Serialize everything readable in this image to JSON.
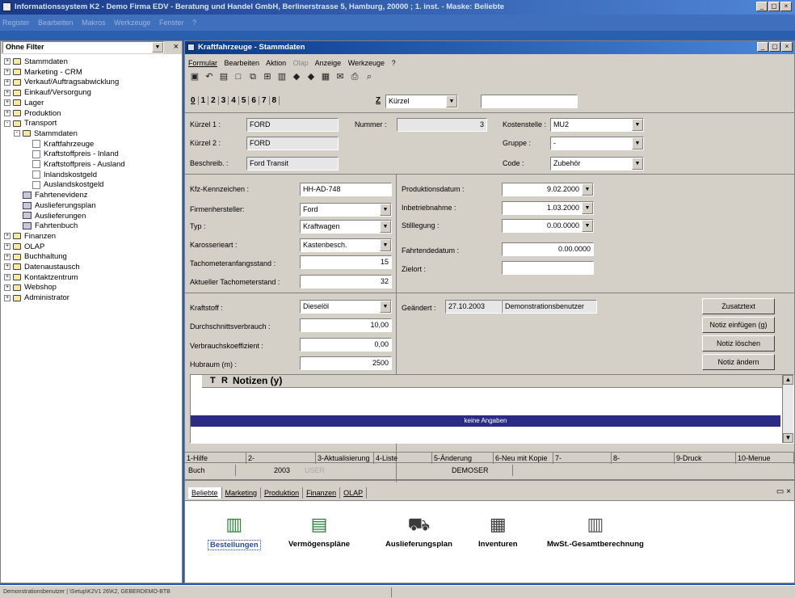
{
  "app": {
    "title": "Informationssystem K2 - Demo Firma EDV - Beratung und Handel GmbH, Berlinerstrasse 5, Hamburg, 20000 ; 1. inst. - Maske: Beliebte",
    "menu": [
      "Register",
      "Bearbeiten",
      "Makros",
      "Werkzeuge",
      "Fenster",
      "?"
    ]
  },
  "sidebar": {
    "filter": "Ohne Filter",
    "items": [
      {
        "label": "Stammdaten",
        "level": 0,
        "sign": "+",
        "icon": "folder"
      },
      {
        "label": "Marketing - CRM",
        "level": 0,
        "sign": "+",
        "icon": "folder"
      },
      {
        "label": "Verkauf/Auftragsabwicklung",
        "level": 0,
        "sign": "+",
        "icon": "folder"
      },
      {
        "label": "Einkauf/Versorgung",
        "level": 0,
        "sign": "+",
        "icon": "folder"
      },
      {
        "label": "Lager",
        "level": 0,
        "sign": "+",
        "icon": "folder"
      },
      {
        "label": "Produktion",
        "level": 0,
        "sign": "+",
        "icon": "folder"
      },
      {
        "label": "Transport",
        "level": 0,
        "sign": "-",
        "icon": "folder"
      },
      {
        "label": "Stammdaten",
        "level": 1,
        "sign": "-",
        "icon": "folder"
      },
      {
        "label": "Kraftfahrzeuge",
        "level": 2,
        "sign": "",
        "icon": "doc"
      },
      {
        "label": "Kraftstoffpreis - Inland",
        "level": 2,
        "sign": "",
        "icon": "doc"
      },
      {
        "label": "Kraftstoffpreis - Ausland",
        "level": 2,
        "sign": "",
        "icon": "doc"
      },
      {
        "label": "Inlandskostgeld",
        "level": 2,
        "sign": "",
        "icon": "doc"
      },
      {
        "label": "Auslandskostgeld",
        "level": 2,
        "sign": "",
        "icon": "doc"
      },
      {
        "label": "Fahrtenevidenz",
        "level": 1,
        "sign": "",
        "icon": "book"
      },
      {
        "label": "Auslieferungsplan",
        "level": 1,
        "sign": "",
        "icon": "book"
      },
      {
        "label": "Auslieferungen",
        "level": 1,
        "sign": "",
        "icon": "book"
      },
      {
        "label": "Fahrtenbuch",
        "level": 1,
        "sign": "",
        "icon": "book"
      },
      {
        "label": "Finanzen",
        "level": 0,
        "sign": "+",
        "icon": "folder"
      },
      {
        "label": "OLAP",
        "level": 0,
        "sign": "+",
        "icon": "folder"
      },
      {
        "label": "Buchhaltung",
        "level": 0,
        "sign": "+",
        "icon": "folder"
      },
      {
        "label": "Datenaustausch",
        "level": 0,
        "sign": "+",
        "icon": "folder"
      },
      {
        "label": "Kontaktzentrum",
        "level": 0,
        "sign": "+",
        "icon": "folder"
      },
      {
        "label": "Webshop",
        "level": 0,
        "sign": "+",
        "icon": "folder"
      },
      {
        "label": "Administrator",
        "level": 0,
        "sign": "+",
        "icon": "folder"
      }
    ]
  },
  "child": {
    "title": "Kraftfahrzeuge - Stammdaten",
    "menu": [
      "Formular",
      "Bearbeiten",
      "Aktion",
      "Olap",
      "Anzeige",
      "Werkzeuge",
      "?"
    ],
    "tabs": [
      "0",
      "1",
      "2",
      "3",
      "4",
      "5",
      "6",
      "7",
      "8"
    ],
    "sort_label": "Z",
    "sort_value": "Kürzel",
    "search_value": ""
  },
  "form": {
    "kurzel1_label": "Kürzel 1 :",
    "kurzel1": "FORD",
    "nummer_label": "Nummer :",
    "nummer": "3",
    "kostenstelle_label": "Kostenstelle :",
    "kostenstelle": "MU2",
    "kurzel2_label": "Kürzel 2 :",
    "kurzel2": "FORD",
    "gruppe_label": "Gruppe :",
    "gruppe": "-",
    "beschreib_label": "Beschreib. :",
    "beschreib": "Ford Transit",
    "code_label": "Code :",
    "code": "Zubehör",
    "kfz_label": "Kfz-Kennzeichen :",
    "kfz": "HH-AD-748",
    "hersteller_label": "Firmenhersteller:",
    "hersteller": "Ford",
    "typ_label": "Typ :",
    "typ": "Kraftwagen",
    "karosserie_label": "Karosserieart :",
    "karosserie": "Kastenbesch.",
    "tacho_start_label": "Tachometeranfangsstand :",
    "tacho_start": "15",
    "tacho_akt_label": "Aktueller Tachometerstand :",
    "tacho_akt": "32",
    "prod_label": "Produktionsdatum :",
    "prod": "9.02.2000",
    "inbetr_label": "Inbetriebnahme :",
    "inbetr": "1.03.2000",
    "still_label": "Stilllegung :",
    "still": "0.00.0000",
    "fahrtende_label": "Fahrtendedatum :",
    "fahrtende": "0.00.0000",
    "zielort_label": "Zielort :",
    "zielort": "",
    "kraftstoff_label": "Kraftstoff :",
    "kraftstoff": "Dieselöl",
    "durchschnitt_label": "Durchschnittsverbrauch :",
    "durchschnitt": "10,00",
    "koeff_label": "Verbrauchskoeffizient :",
    "koeff": "0,00",
    "hubraum_label": "Hubraum (m) :",
    "hubraum": "2500",
    "geandert_label": "Geändert :",
    "geandert_date": "27.10.2003",
    "geandert_user": "Demonstrationsbenutzer"
  },
  "buttons": {
    "zusatztext": "Zusatztext",
    "notiz_einfuegen": "Notiz einfügen (g)",
    "notiz_loeschen": "Notiz löschen",
    "notiz_aendern": "Notiz ändern"
  },
  "notes": {
    "col_t": "T",
    "col_r": "R",
    "col_notizen": "Notizen (y)",
    "empty": "keine Angaben"
  },
  "fkeys": [
    "1-Hilfe",
    "2-",
    "3-Aktualisierung",
    "4-Liste",
    "5-Änderung",
    "6-Neu mit Kopie",
    "7-",
    "8-",
    "9-Druck",
    "10-Menue"
  ],
  "statusbar": {
    "buch": "Buch",
    "year": "2003",
    "user_dim": "USER",
    "demoser": "DEMOSER"
  },
  "favorites": {
    "tabs": [
      "Beliebte",
      "Marketing",
      "Produktion",
      "Finanzen",
      "OLAP"
    ],
    "items": [
      {
        "label": "Bestellungen",
        "icon": "bestellungen-icon"
      },
      {
        "label": "Vermögenspläne",
        "icon": "vermoegensplaene-icon"
      },
      {
        "label": "Auslieferungsplan",
        "icon": "truck-icon"
      },
      {
        "label": "Inventuren",
        "icon": "inventuren-icon"
      },
      {
        "label": "MwSt.-Gesamtberechnung",
        "icon": "book-icon"
      }
    ]
  },
  "bottom_status": "Demonstrationsbenutzer | \\Setup\\K2V1 26\\K2, GEBERDEMO-BTB"
}
